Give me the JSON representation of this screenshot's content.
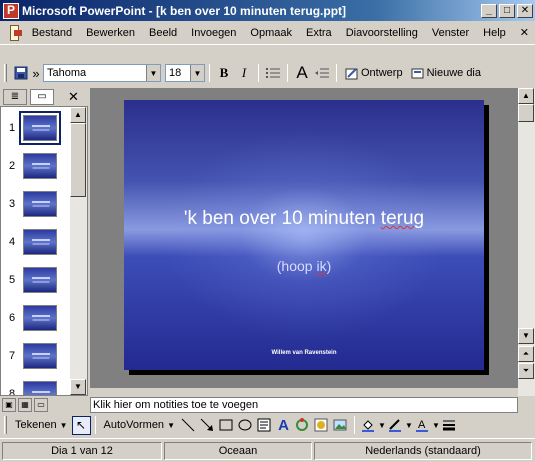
{
  "window": {
    "title": "Microsoft PowerPoint - [k ben over 10 minuten terug.ppt]",
    "min_glyph": "_",
    "max_glyph": "□",
    "close_glyph": "✕"
  },
  "menu": {
    "items": [
      "Bestand",
      "Bewerken",
      "Beeld",
      "Invoegen",
      "Opmaak",
      "Extra",
      "Diavoorstelling",
      "Venster",
      "Help"
    ],
    "close_doc_glyph": "✕"
  },
  "toolbar": {
    "font_name": "Tahoma",
    "font_size": "18",
    "bold": "B",
    "italic": "I",
    "design_label": "Ontwerp",
    "new_slide_label": "Nieuwe dia",
    "overflow_glyph": "»"
  },
  "slides_pane": {
    "close_glyph": "✕",
    "numbers": [
      "1",
      "2",
      "3",
      "4",
      "5",
      "6",
      "7",
      "8"
    ],
    "selected": "1"
  },
  "slide": {
    "title_prefix": "'k ben over 10 minuten ",
    "title_underlined": "terug",
    "subtitle_prefix": "(hoop ",
    "subtitle_underlined": "ik",
    "subtitle_suffix": ")",
    "author": "Willem van Ravenstein"
  },
  "notes": {
    "placeholder": "Klik hier om notities toe te voegen"
  },
  "draw_toolbar": {
    "draw_label": "Tekenen",
    "autoshapes_label": "AutoVormen"
  },
  "status": {
    "slide_position": "Dia 1 van 12",
    "design": "Oceaan",
    "language": "Nederlands (standaard)"
  },
  "colors": {
    "titlebar_start": "#0a246a",
    "chrome": "#d4d0c8",
    "slide_blue": "#3d4db8"
  }
}
